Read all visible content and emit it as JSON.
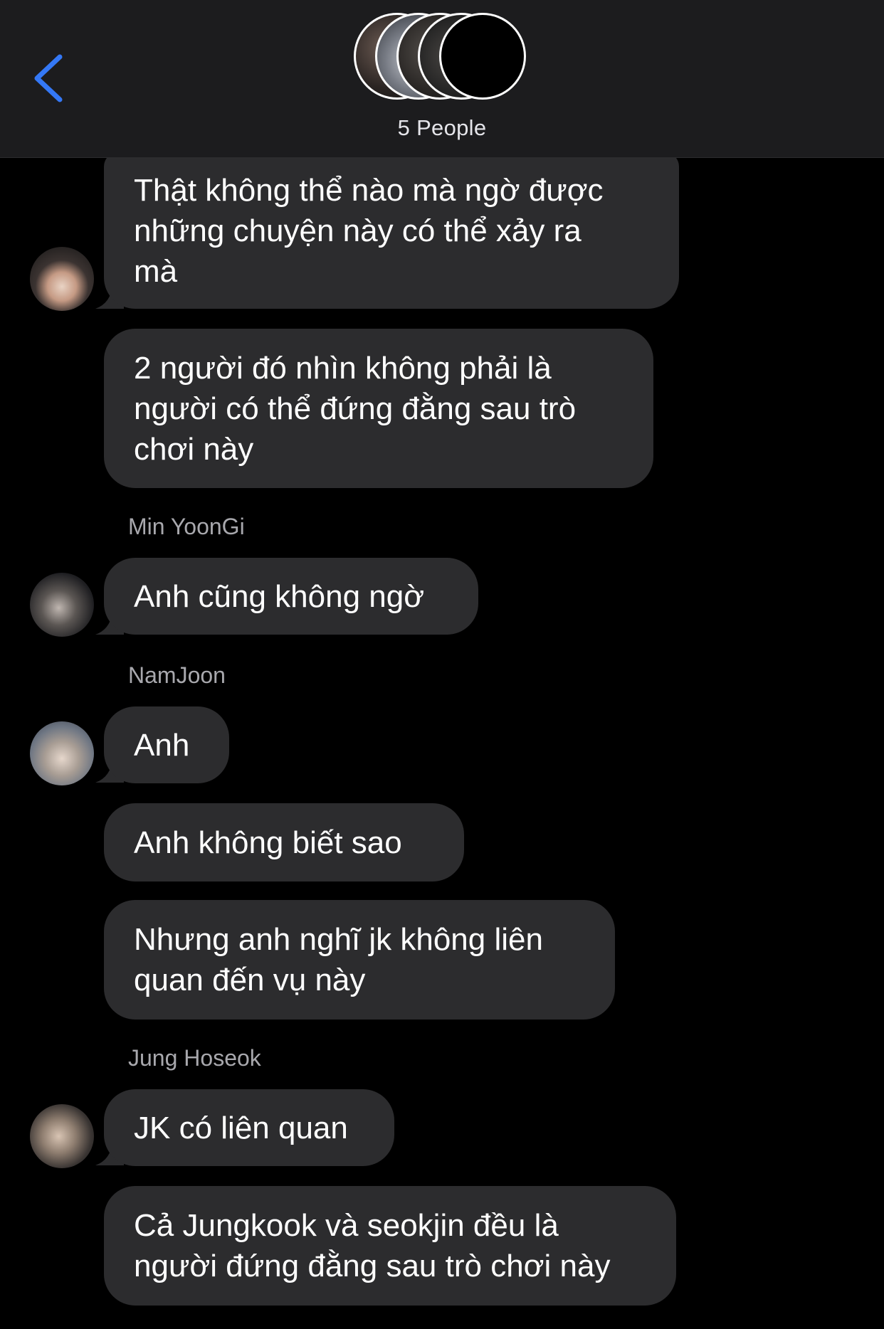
{
  "header": {
    "back_icon": "chevron-left-icon",
    "title": "5 People",
    "accent_color": "#3478f6"
  },
  "messages": [
    {
      "sender": "",
      "text": "Thật không thể nào mà ngờ được\nnhững chuyện này có thể xảy ra\nmà"
    },
    {
      "sender": "",
      "text": "2 người đó nhìn không phải là\nngười có thể đứng đằng sau trò\nchơi này"
    },
    {
      "sender": "Min YoonGi",
      "text": "Anh cũng không ngờ"
    },
    {
      "sender": "NamJoon",
      "text": "Anh"
    },
    {
      "sender": "",
      "text": "Anh không biết sao"
    },
    {
      "sender": "",
      "text": "Nhưng anh nghĩ jk không liên\nquan đến vụ này"
    },
    {
      "sender": "Jung Hoseok",
      "text": "JK có liên quan"
    },
    {
      "sender": "",
      "text": "Cả Jungkook và seokjin đều là\nngười đứng đằng sau trò chơi này"
    }
  ],
  "colors": {
    "background": "#000000",
    "header_bg": "#1c1c1e",
    "bubble_bg": "#2c2c2e",
    "sender_text": "#a8a8ad"
  }
}
